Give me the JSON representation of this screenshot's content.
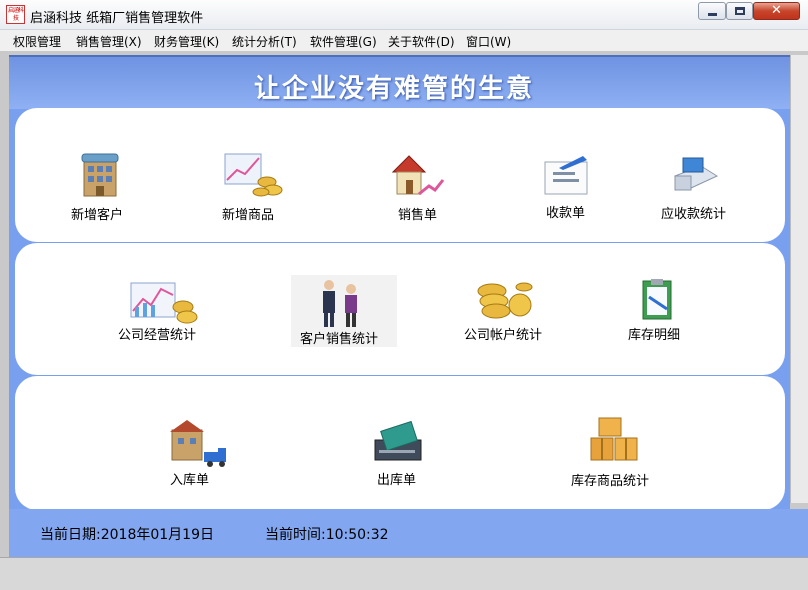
{
  "window": {
    "logo_text": "启涵科技",
    "title": "启涵科技 纸箱厂销售管理软件",
    "close_glyph": "✕"
  },
  "menu": [
    "权限管理",
    "销售管理(X)",
    "财务管理(K)",
    "统计分析(T)",
    "软件管理(G)",
    "关于软件(D)",
    "窗口(W)"
  ],
  "slogan": "让企业没有难管的生意",
  "tiles": {
    "add_customer": "新增客户",
    "add_product": "新增商品",
    "sales_order": "销售单",
    "receipt": "收款单",
    "receivable_stats": "应收款统计",
    "company_operation_stats": "公司经营统计",
    "customer_sales_stats": "客户销售统计",
    "company_account_stats": "公司帐户统计",
    "inventory_detail": "库存明细",
    "stock_in": "入库单",
    "stock_out": "出库单",
    "inventory_product_stats": "库存商品统计"
  },
  "status": {
    "current_date": "当前日期:2018年01月19日",
    "current_time": "当前时间:10:50:32"
  },
  "colors": {
    "accent_blue": "#78a0ee",
    "close_red": "#c7452b",
    "panel_white": "#ffffff"
  }
}
